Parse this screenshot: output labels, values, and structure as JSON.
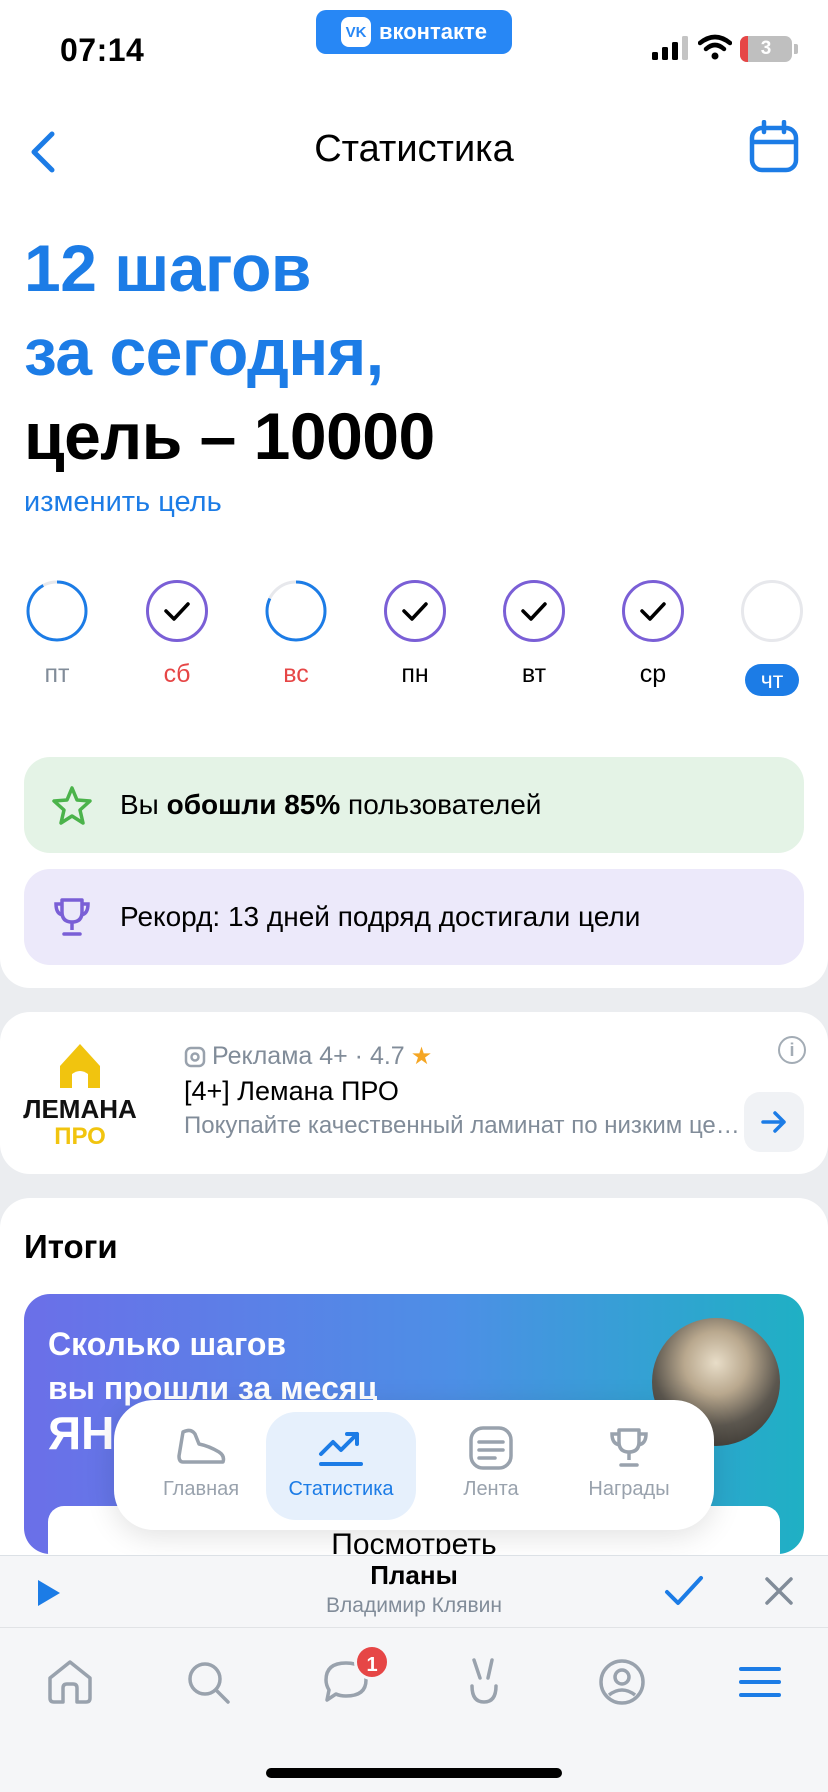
{
  "status_bar": {
    "time": "07:14",
    "app_pill": "вконтакте",
    "vk_logo": "VK",
    "battery": "3"
  },
  "nav": {
    "title": "Статистика",
    "back_icon": "chevron-left-icon",
    "calendar_icon": "calendar-icon"
  },
  "headline": {
    "line1": "12 шагов",
    "line2": "за сегодня,",
    "line3": "цель – 10000"
  },
  "change_goal": "изменить цель",
  "days": [
    {
      "label": "пт",
      "status": "partial",
      "progress": 0.92,
      "label_color": "gray"
    },
    {
      "label": "сб",
      "status": "done",
      "label_color": "red"
    },
    {
      "label": "вс",
      "status": "partial",
      "progress": 0.82,
      "label_color": "red"
    },
    {
      "label": "пн",
      "status": "done",
      "label_color": "dark"
    },
    {
      "label": "вт",
      "status": "done",
      "label_color": "dark"
    },
    {
      "label": "ср",
      "status": "done",
      "label_color": "dark"
    },
    {
      "label": "чт",
      "status": "today",
      "label_color": "today"
    }
  ],
  "stats": {
    "percent_prefix": "Вы ",
    "percent_bold": "обошли 85%",
    "percent_suffix": " пользователей",
    "record": "Рекорд: 13 дней подряд достигали цели"
  },
  "ad": {
    "logo_line1": "ЛЕМАНА",
    "logo_line2": "ПРО",
    "meta": "Реклама 4+ · 4.7",
    "title": "[4+] Лемана ПРО",
    "description": "Покупайте качественный ламинат по низким ценам",
    "info_icon": "i"
  },
  "results": {
    "title": "Итоги",
    "promo_text_1": "Сколько шагов",
    "promo_text_2": "вы прошли за месяц",
    "promo_month": "ЯН",
    "button": "Посмотреть"
  },
  "floating_tabs": [
    {
      "label": "Главная",
      "icon": "shoe-icon",
      "active": false
    },
    {
      "label": "Статистика",
      "icon": "chart-trend-icon",
      "active": true
    },
    {
      "label": "Лента",
      "icon": "feed-icon",
      "active": false
    },
    {
      "label": "Награды",
      "icon": "trophy-icon",
      "active": false
    }
  ],
  "player": {
    "title": "Планы",
    "artist": "Владимир Клявин"
  },
  "bottom_tabs": {
    "items": [
      "home-icon",
      "search-icon",
      "messages-icon",
      "clips-icon",
      "profile-icon",
      "menu-icon"
    ],
    "messages_badge": "1"
  },
  "colors": {
    "accent": "#1c7ce6",
    "check_ring": "#7a5fd6",
    "red": "#e64646",
    "green_bg": "#e4f3e6",
    "purple_bg": "#ece9fa"
  }
}
